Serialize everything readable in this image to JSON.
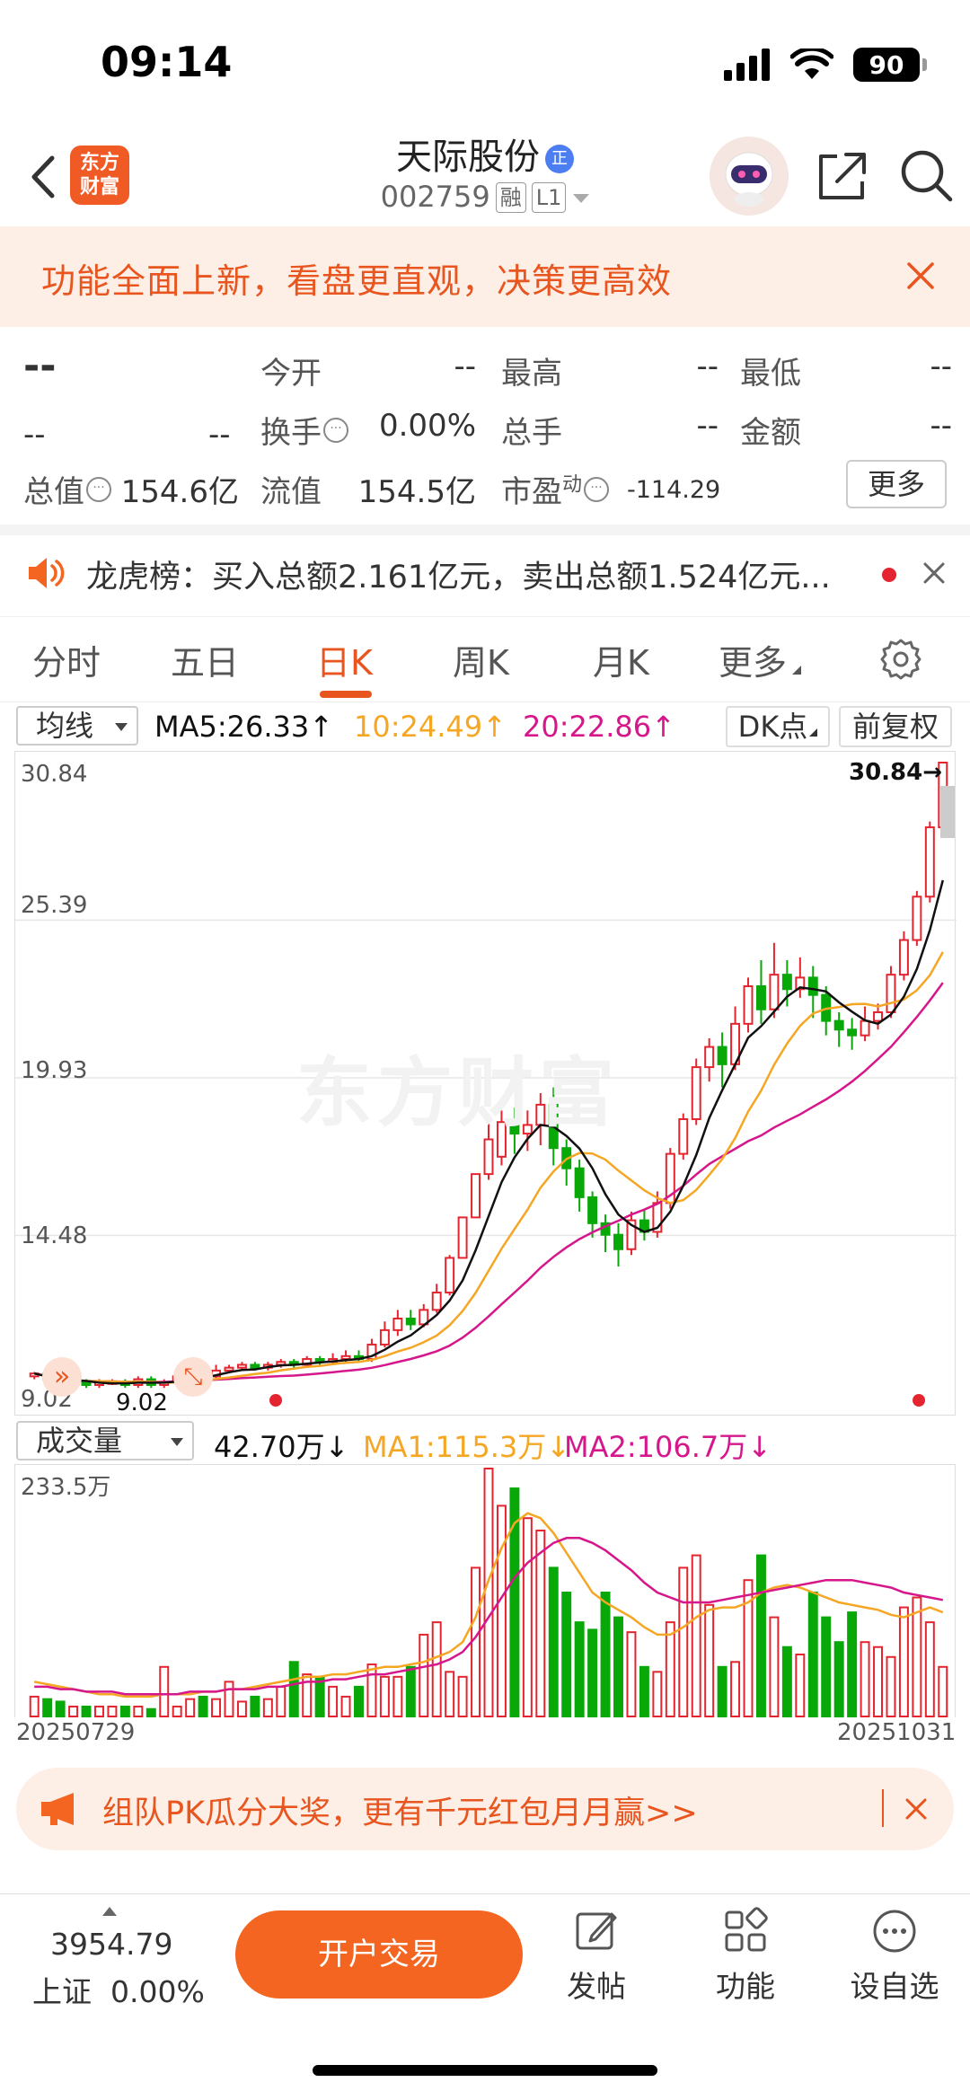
{
  "status_bar": {
    "time": "09:14",
    "battery": "90"
  },
  "header": {
    "logo_line1": "东方",
    "logo_line2": "财富",
    "stock_name": "天际股份",
    "verify_badge": "正",
    "stock_code": "002759",
    "tag_margin": "融",
    "tag_level": "L1"
  },
  "banner": {
    "text": "功能全面上新，看盘更直观，决策更高效"
  },
  "quote": {
    "price": "--",
    "change": "--",
    "change_pct": "--",
    "open_label": "今开",
    "open_value": "--",
    "high_label": "最高",
    "high_value": "--",
    "low_label": "最低",
    "low_value": "--",
    "turnover_label": "换手",
    "turnover_value": "0.00%",
    "volume_label": "总手",
    "volume_value": "--",
    "amount_label": "金额",
    "amount_value": "--",
    "mktcap_label": "总值",
    "mktcap_value": "154.6亿",
    "float_label": "流值",
    "float_value": "154.5亿",
    "pe_label": "市盈",
    "pe_sup": "动",
    "pe_value": "-114.29",
    "more_label": "更多"
  },
  "lhb": {
    "text": "龙虎榜：买入总额2.161亿元，卖出总额1.524亿元..."
  },
  "tabs": [
    {
      "label": "分时",
      "active": false
    },
    {
      "label": "五日",
      "active": false
    },
    {
      "label": "日K",
      "active": true
    },
    {
      "label": "周K",
      "active": false
    },
    {
      "label": "月K",
      "active": false
    },
    {
      "label": "更多",
      "active": false
    }
  ],
  "ma_row": {
    "select": "均线",
    "ma5": "MA5:26.33↑",
    "ma10": "10:24.49↑",
    "ma20": "20:22.86↑",
    "dk_label": "DK点",
    "adjust_label": "前复权"
  },
  "vol_row": {
    "select": "成交量",
    "vol": "42.70万↓",
    "ma1": "MA1:115.3万↓",
    "ma2": "MA2:106.7万↓"
  },
  "colors": {
    "up": "#e4252f",
    "down": "#08a808",
    "ma5": "#111111",
    "ma10": "#f5a623",
    "ma20": "#d6178c",
    "accent": "#e8551e"
  },
  "chart_data": {
    "type": "candlestick",
    "y_ticks": [
      "30.84",
      "25.39",
      "19.93",
      "14.48",
      "9.02"
    ],
    "ylim": [
      9.02,
      30.84
    ],
    "last_price_label": "30.84→",
    "low_marker_label": "9.02",
    "start_date": "20250729",
    "end_date": "20251031",
    "vol_max_label": "233.5万",
    "candles": [
      [
        9.6,
        9.7,
        9.5,
        9.75
      ],
      [
        9.7,
        9.5,
        9.4,
        9.8
      ],
      [
        9.5,
        9.3,
        9.2,
        9.6
      ],
      [
        9.3,
        9.4,
        9.2,
        9.5
      ],
      [
        9.4,
        9.3,
        9.2,
        9.5
      ],
      [
        9.3,
        9.4,
        9.2,
        9.5
      ],
      [
        9.4,
        9.4,
        9.3,
        9.5
      ],
      [
        9.4,
        9.3,
        9.2,
        9.5
      ],
      [
        9.3,
        9.5,
        9.2,
        9.6
      ],
      [
        9.5,
        9.3,
        9.2,
        9.6
      ],
      [
        9.3,
        9.4,
        9.2,
        9.5
      ],
      [
        9.4,
        9.6,
        9.3,
        9.7
      ],
      [
        9.6,
        9.8,
        9.5,
        9.9
      ],
      [
        9.8,
        9.6,
        9.5,
        9.9
      ],
      [
        9.6,
        9.8,
        9.5,
        10.0
      ],
      [
        9.8,
        9.9,
        9.7,
        10.0
      ],
      [
        9.9,
        10.0,
        9.8,
        10.1
      ],
      [
        10.0,
        9.9,
        9.8,
        10.1
      ],
      [
        9.9,
        10.0,
        9.8,
        10.1
      ],
      [
        10.0,
        10.1,
        9.9,
        10.2
      ],
      [
        10.1,
        10.0,
        9.9,
        10.2
      ],
      [
        10.0,
        10.2,
        9.9,
        10.3
      ],
      [
        10.2,
        10.1,
        10.0,
        10.3
      ],
      [
        10.1,
        10.2,
        10.0,
        10.4
      ],
      [
        10.2,
        10.3,
        10.1,
        10.5
      ],
      [
        10.3,
        10.2,
        10.1,
        10.5
      ],
      [
        10.2,
        10.7,
        10.1,
        10.9
      ],
      [
        10.7,
        11.2,
        10.6,
        11.5
      ],
      [
        11.2,
        11.6,
        11.0,
        11.9
      ],
      [
        11.6,
        11.4,
        11.2,
        11.9
      ],
      [
        11.4,
        11.9,
        11.3,
        12.1
      ],
      [
        11.9,
        12.5,
        11.8,
        12.8
      ],
      [
        12.5,
        13.7,
        12.4,
        13.8
      ],
      [
        13.7,
        15.1,
        13.7,
        15.1
      ],
      [
        15.1,
        16.6,
        15.1,
        16.6
      ],
      [
        16.6,
        17.8,
        16.4,
        18.4
      ],
      [
        17.2,
        18.4,
        16.9,
        18.8
      ],
      [
        18.4,
        18.0,
        17.3,
        18.9
      ],
      [
        18.0,
        18.3,
        17.4,
        18.8
      ],
      [
        18.3,
        19.0,
        17.6,
        19.4
      ],
      [
        19.0,
        17.5,
        16.9,
        19.6
      ],
      [
        17.5,
        16.8,
        16.2,
        17.8
      ],
      [
        16.8,
        15.8,
        15.3,
        17.1
      ],
      [
        15.8,
        14.9,
        14.4,
        16.0
      ],
      [
        14.9,
        14.5,
        13.9,
        15.2
      ],
      [
        14.5,
        14.0,
        13.4,
        14.9
      ],
      [
        14.0,
        15.0,
        13.8,
        15.3
      ],
      [
        15.0,
        14.6,
        14.3,
        15.4
      ],
      [
        14.6,
        15.6,
        14.4,
        16.0
      ],
      [
        15.6,
        17.3,
        15.4,
        17.5
      ],
      [
        17.3,
        18.5,
        17.1,
        18.7
      ],
      [
        18.5,
        20.3,
        18.3,
        20.6
      ],
      [
        20.3,
        21.0,
        19.8,
        21.3
      ],
      [
        21.0,
        20.4,
        19.6,
        21.5
      ],
      [
        20.4,
        21.8,
        20.2,
        22.4
      ],
      [
        21.8,
        23.1,
        21.5,
        23.4
      ],
      [
        23.1,
        22.3,
        21.8,
        24.0
      ],
      [
        22.3,
        23.5,
        22.0,
        24.6
      ],
      [
        23.5,
        23.0,
        22.4,
        24.0
      ],
      [
        23.0,
        23.4,
        22.7,
        24.1
      ],
      [
        23.4,
        22.8,
        22.0,
        23.8
      ],
      [
        22.8,
        21.9,
        21.4,
        23.1
      ],
      [
        21.9,
        21.6,
        21.0,
        22.2
      ],
      [
        21.6,
        21.4,
        20.9,
        22.0
      ],
      [
        21.4,
        21.9,
        21.2,
        22.4
      ],
      [
        21.9,
        22.2,
        21.6,
        22.5
      ],
      [
        22.2,
        23.5,
        22.0,
        23.8
      ],
      [
        23.5,
        24.7,
        23.3,
        25.0
      ],
      [
        24.7,
        26.2,
        24.5,
        26.4
      ],
      [
        26.2,
        28.6,
        26.0,
        28.8
      ],
      [
        28.6,
        30.84,
        28.5,
        30.84
      ]
    ],
    "volumes": [
      8,
      7,
      6,
      4,
      4,
      4,
      4,
      4,
      4,
      3,
      20,
      4,
      7,
      8,
      7,
      14,
      6,
      8,
      7,
      12,
      22,
      17,
      16,
      12,
      8,
      12,
      21,
      16,
      16,
      20,
      33,
      38,
      18,
      16,
      60,
      100,
      85,
      92,
      80,
      75,
      60,
      50,
      38,
      35,
      50,
      40,
      34,
      20,
      18,
      38,
      60,
      65,
      45,
      20,
      22,
      55,
      65,
      40,
      28,
      25,
      50,
      40,
      30,
      42,
      30,
      28,
      24,
      44,
      48,
      38,
      20
    ],
    "ma1": [
      14,
      13,
      12,
      11,
      10,
      9,
      9,
      8,
      8,
      8,
      9,
      9,
      9,
      10,
      10,
      11,
      11,
      12,
      13,
      14,
      15,
      16,
      16,
      17,
      17,
      18,
      19,
      20,
      20,
      21,
      22,
      24,
      26,
      30,
      40,
      55,
      68,
      78,
      82,
      80,
      74,
      66,
      58,
      50,
      46,
      43,
      40,
      36,
      33,
      33,
      36,
      40,
      43,
      44,
      44,
      46,
      50,
      52,
      53,
      52,
      50,
      48,
      46,
      45,
      44,
      43,
      41,
      40,
      42,
      44,
      42
    ],
    "ma2": [
      12,
      12,
      11,
      11,
      10,
      10,
      10,
      9,
      9,
      9,
      9,
      9,
      10,
      10,
      10,
      11,
      11,
      11,
      12,
      12,
      13,
      14,
      14,
      15,
      15,
      16,
      17,
      17,
      18,
      19,
      20,
      21,
      23,
      26,
      32,
      40,
      48,
      56,
      62,
      66,
      70,
      72,
      72,
      70,
      67,
      63,
      59,
      54,
      50,
      48,
      46,
      46,
      46,
      47,
      48,
      49,
      50,
      51,
      52,
      53,
      54,
      55,
      55,
      55,
      54,
      53,
      52,
      50,
      49,
      48,
      47
    ]
  },
  "promo": {
    "text": "组队PK瓜分大奖，更有千元红包月月赢>>"
  },
  "bottom": {
    "index_value": "3954.79",
    "index_name": "上证",
    "index_change": "0.00%",
    "trade_label": "开户交易",
    "post_label": "发帖",
    "func_label": "功能",
    "watch_label": "设自选"
  },
  "watermark": "东方财富"
}
